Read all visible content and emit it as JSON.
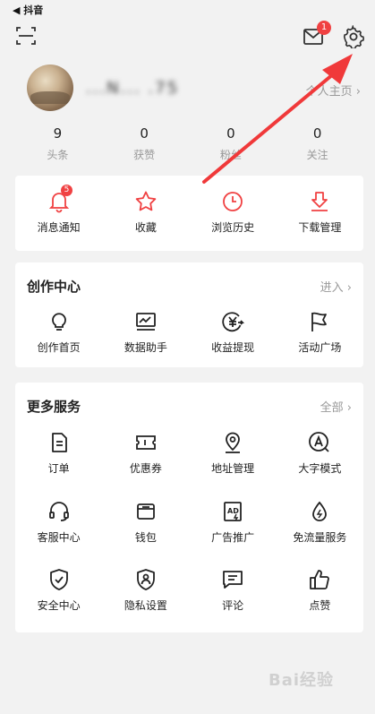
{
  "status_bar": {
    "back_label": "◀ 抖音"
  },
  "header": {
    "scan_icon": "scan-icon",
    "mail_icon": "mail-icon",
    "mail_badge": "1",
    "settings_icon": "gear-icon"
  },
  "profile": {
    "username": "...N... .75",
    "homepage_link": "个人主页 ›"
  },
  "stats": [
    {
      "value": "9",
      "label": "头条"
    },
    {
      "value": "0",
      "label": "获赞"
    },
    {
      "value": "0",
      "label": "粉丝"
    },
    {
      "value": "0",
      "label": "关注"
    }
  ],
  "quick_actions": [
    {
      "label": "消息通知",
      "icon": "bell-icon",
      "badge": "5"
    },
    {
      "label": "收藏",
      "icon": "star-icon"
    },
    {
      "label": "浏览历史",
      "icon": "clock-icon"
    },
    {
      "label": "下载管理",
      "icon": "download-icon"
    }
  ],
  "create_center": {
    "title": "创作中心",
    "more": "进入 ›",
    "items": [
      {
        "label": "创作首页",
        "icon": "lightbulb-icon"
      },
      {
        "label": "数据助手",
        "icon": "chart-icon"
      },
      {
        "label": "收益提现",
        "icon": "yuan-icon"
      },
      {
        "label": "活动广场",
        "icon": "flag-icon"
      }
    ]
  },
  "more_services": {
    "title": "更多服务",
    "more": "全部 ›",
    "items": [
      {
        "label": "订单",
        "icon": "order-icon"
      },
      {
        "label": "优惠券",
        "icon": "coupon-icon"
      },
      {
        "label": "地址管理",
        "icon": "location-icon"
      },
      {
        "label": "大字模式",
        "icon": "font-size-icon"
      },
      {
        "label": "客服中心",
        "icon": "headset-icon"
      },
      {
        "label": "钱包",
        "icon": "wallet-icon"
      },
      {
        "label": "广告推广",
        "icon": "ad-icon"
      },
      {
        "label": "免流量服务",
        "icon": "data-drop-icon"
      },
      {
        "label": "安全中心",
        "icon": "shield-icon"
      },
      {
        "label": "隐私设置",
        "icon": "privacy-icon"
      },
      {
        "label": "评论",
        "icon": "comment-icon"
      },
      {
        "label": "点赞",
        "icon": "thumbs-up-icon"
      }
    ]
  },
  "colors": {
    "accent_red": "#f04142",
    "annotation_arrow": "#f0393a"
  }
}
